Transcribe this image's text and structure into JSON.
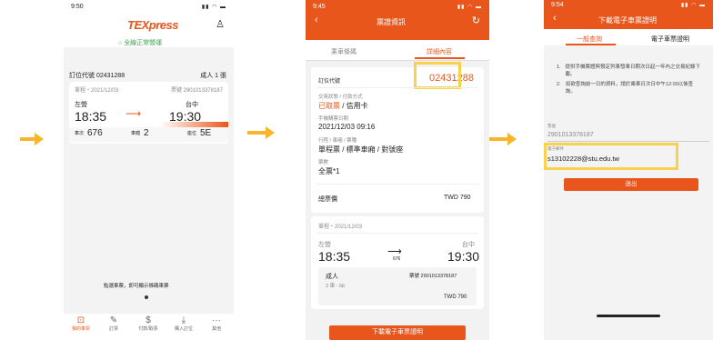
{
  "p1": {
    "status_time": "9:50",
    "brand": "TEXpress",
    "service_status": "全線正常營運",
    "order_label": "訂位代號 02431288",
    "pax": "成人 1 張",
    "trip_date": "單程・2021/12/03",
    "ticket_no": "票號 2901013378187",
    "from_station": "左營",
    "to_station": "台中",
    "dep_time": "18:35",
    "arr_time": "19:30",
    "train_label": "車次",
    "train_no": "676",
    "car_label": "車廂",
    "car_no": "2",
    "seat_label": "座位",
    "seat_no": "5E",
    "note": "點選車票，即可顯示條碼車票",
    "tabs": [
      "我的車票",
      "訂票",
      "付款/取票",
      "購入訂位",
      "其他"
    ]
  },
  "p2": {
    "status_time": "9:45",
    "title": "票證資訊",
    "tab1": "乘車條碼",
    "tab2": "詳細內容",
    "order_label": "訂位代號",
    "order_no": "02431288",
    "pay_label": "交易狀態 / 付款方式",
    "pay_status": "已取票",
    "pay_method": "/ 信用卡",
    "purchase_label": "手機購票日期",
    "purchase_date": "2021/12/03 09:16",
    "type_label": "行程 / 車廂 / 票種",
    "type_value": "單程票 / 標準車廂 / 對號座",
    "ticket_label": "票數",
    "ticket_value": "全票*1",
    "total_label": "總票價",
    "total_value": "TWD 790",
    "trip_date": "單程・2021/12/03",
    "from_station": "左營",
    "to_station": "台中",
    "dep_time": "18:35",
    "arr_time": "19:30",
    "train_no": "676",
    "pax": "成人",
    "ticket_no": "票號 2901013378187",
    "car_seat": "2 車 - 5E",
    "price": "TWD 790",
    "action_button": "下載電子車票證明"
  },
  "p3": {
    "status_time": "9:54",
    "title": "下載電子車票證明",
    "tab1": "一般查詢",
    "tab2": "電子車票證明",
    "note1": "提供手機票證與預定列車發車日期次日起一年內之交易紀錄下載。",
    "note2": "如欲查詢前一日的資料，請於乘車日次日中午12:00以後查詢。",
    "ticket_label": "票號",
    "ticket_value": "2901013378187",
    "email_label": "電子郵件",
    "email_value": "s1310222​8@stu.edu.tw",
    "submit": "送出"
  }
}
